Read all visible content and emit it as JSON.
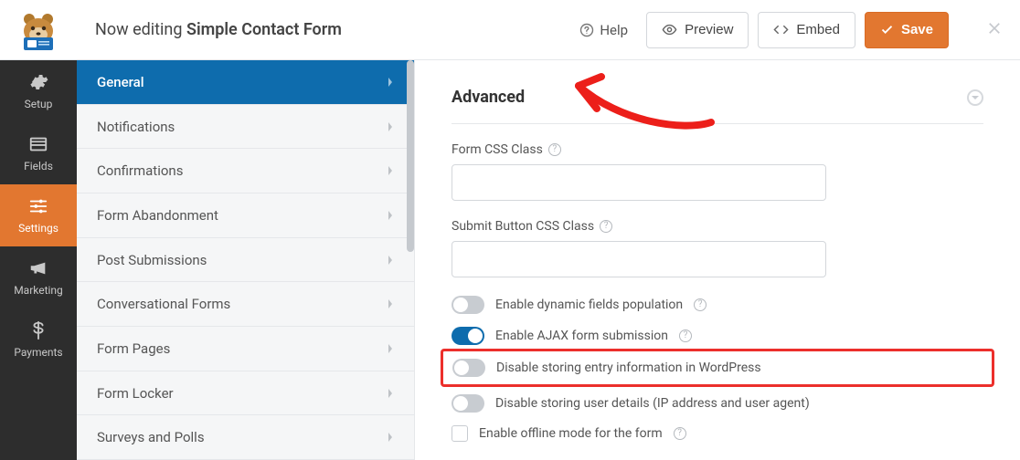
{
  "header": {
    "editing_prefix": "Now editing ",
    "form_name": "Simple Contact Form",
    "help_label": "Help",
    "preview_label": "Preview",
    "embed_label": "Embed",
    "save_label": "Save"
  },
  "rail": [
    {
      "key": "setup",
      "label": "Setup"
    },
    {
      "key": "fields",
      "label": "Fields"
    },
    {
      "key": "settings",
      "label": "Settings",
      "active": true
    },
    {
      "key": "marketing",
      "label": "Marketing"
    },
    {
      "key": "payments",
      "label": "Payments"
    }
  ],
  "settings_menu": [
    {
      "key": "general",
      "label": "General",
      "active": true
    },
    {
      "key": "notifications",
      "label": "Notifications"
    },
    {
      "key": "confirmations",
      "label": "Confirmations"
    },
    {
      "key": "abandonment",
      "label": "Form Abandonment"
    },
    {
      "key": "post-subs",
      "label": "Post Submissions"
    },
    {
      "key": "conversational",
      "label": "Conversational Forms"
    },
    {
      "key": "form-pages",
      "label": "Form Pages"
    },
    {
      "key": "form-locker",
      "label": "Form Locker"
    },
    {
      "key": "surveys",
      "label": "Surveys and Polls"
    }
  ],
  "advanced": {
    "title": "Advanced",
    "form_css_label": "Form CSS Class",
    "form_css_value": "",
    "submit_css_label": "Submit Button CSS Class",
    "submit_css_value": "",
    "toggles": {
      "dynamic_fields": {
        "label": "Enable dynamic fields population",
        "on": false,
        "help": true
      },
      "ajax": {
        "label": "Enable AJAX form submission",
        "on": true,
        "help": true
      },
      "disable_entry": {
        "label": "Disable storing entry information in WordPress",
        "on": false,
        "highlight": true
      },
      "disable_user": {
        "label": "Disable storing user details (IP address and user agent)",
        "on": false
      },
      "offline": {
        "label": "Enable offline mode for the form",
        "checkbox": true,
        "help": true
      }
    }
  }
}
